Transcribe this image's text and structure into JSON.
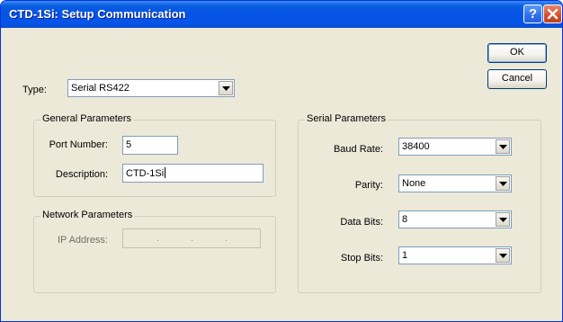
{
  "window": {
    "title": "CTD-1Si: Setup Communication"
  },
  "buttons": {
    "ok": "OK",
    "cancel": "Cancel",
    "help_glyph": "?"
  },
  "type": {
    "label": "Type:",
    "value": "Serial RS422"
  },
  "general": {
    "title": "General Parameters",
    "port_label": "Port Number:",
    "port_value": "5",
    "desc_label": "Description:",
    "desc_value": "CTD-1Si"
  },
  "network": {
    "title": "Network Parameters",
    "ip_label": "IP Address:",
    "ip_dots": [
      ".",
      ".",
      "."
    ]
  },
  "serial": {
    "title": "Serial Parameters",
    "baud_label": "Baud Rate:",
    "baud_value": "38400",
    "parity_label": "Parity:",
    "parity_value": "None",
    "databits_label": "Data Bits:",
    "databits_value": "8",
    "stopbits_label": "Stop Bits:",
    "stopbits_value": "1"
  },
  "icons": {
    "help": "help-icon",
    "close": "close-icon",
    "dropdown": "chevron-down-icon"
  },
  "colors": {
    "titlebar": "#0554e3",
    "dialog_bg": "#ece9d8",
    "close_button": "#d8512f",
    "field_border": "#7f9db9"
  }
}
